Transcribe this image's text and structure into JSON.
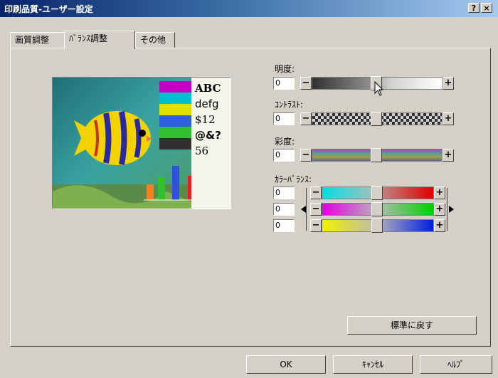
{
  "window": {
    "title": "印刷品質-ユーザー設定",
    "help_btn": "?",
    "close_btn": "×"
  },
  "tabs": [
    {
      "label": "画質調整"
    },
    {
      "label": "ﾊﾞﾗﾝｽ調整"
    },
    {
      "label": "その他"
    }
  ],
  "preview": {
    "lines": [
      "ABC",
      "defg",
      "$12",
      "@&?",
      "56"
    ]
  },
  "brightness": {
    "label": "明度:",
    "value": "0",
    "minus": "−",
    "plus": "+"
  },
  "contrast": {
    "label": "ｺﾝﾄﾗｽﾄ:",
    "value": "0",
    "minus": "−",
    "plus": "+"
  },
  "saturation": {
    "label": "彩度:",
    "value": "0",
    "minus": "−",
    "plus": "+"
  },
  "color_balance": {
    "label": "ｶﾗｰﾊﾞﾗﾝｽ:",
    "rows": [
      {
        "value": "0",
        "minus": "−",
        "plus": "+"
      },
      {
        "value": "0",
        "minus": "−",
        "plus": "+"
      },
      {
        "value": "0",
        "minus": "−",
        "plus": "+"
      }
    ]
  },
  "restore_button": "標準に戻す",
  "buttons": {
    "ok": "OK",
    "cancel": "ｷｬﾝｾﾙ",
    "help": "ﾍﾙﾌﾟ"
  }
}
